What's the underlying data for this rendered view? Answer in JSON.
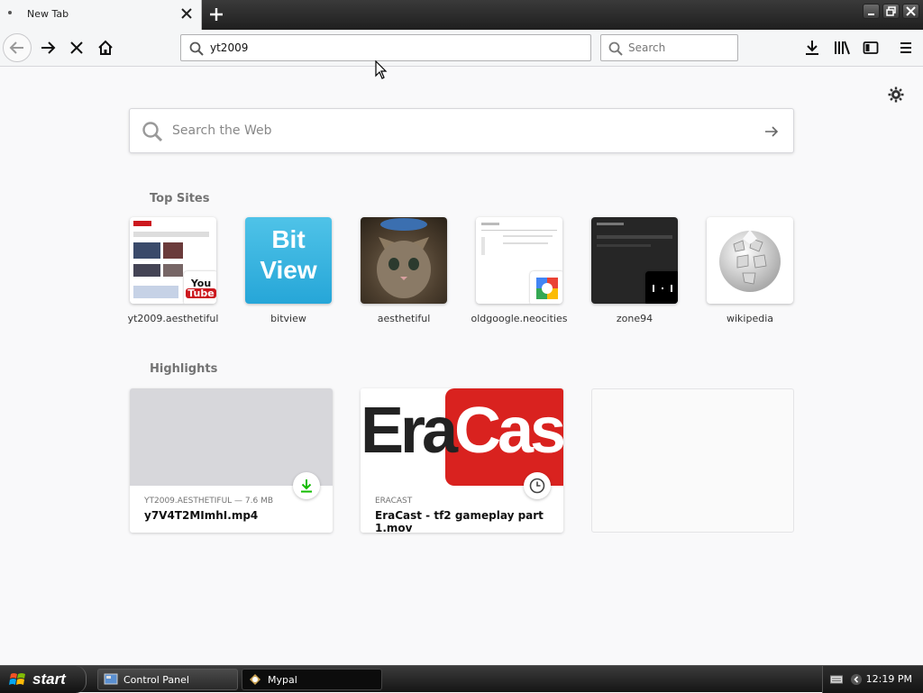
{
  "tab": {
    "title": "New Tab"
  },
  "toolbar": {
    "url": "yt2009",
    "search_placeholder": "Search"
  },
  "content": {
    "web_search_placeholder": "Search the Web",
    "top_sites_heading": "Top Sites",
    "top_sites": [
      {
        "label": "yt2009.aesthetiful"
      },
      {
        "label": "bitview"
      },
      {
        "label": "aesthetiful"
      },
      {
        "label": "oldgoogle.neocities"
      },
      {
        "label": "zone94"
      },
      {
        "label": "wikipedia"
      }
    ],
    "highlights_heading": "Highlights",
    "highlights": [
      {
        "meta": "YT2009.AESTHETIFUL — 7.6 MB",
        "name": "y7V4T2MImhI.mp4"
      },
      {
        "meta": "ERACAST",
        "name": "EraCast - tf2 gameplay part 1.mov"
      }
    ],
    "bitview_logo": [
      "Bit",
      "View"
    ],
    "youtube_logo": [
      "You",
      "Tube"
    ],
    "eracast_logo": [
      "Era",
      "Cast"
    ]
  },
  "taskbar": {
    "start_label": "start",
    "tasks": [
      {
        "label": "Control Panel"
      },
      {
        "label": "Mypal"
      }
    ],
    "clock": "12:19 PM"
  },
  "colors": {
    "accent_green": "#12bc00",
    "eracast_red": "#d9221f"
  }
}
